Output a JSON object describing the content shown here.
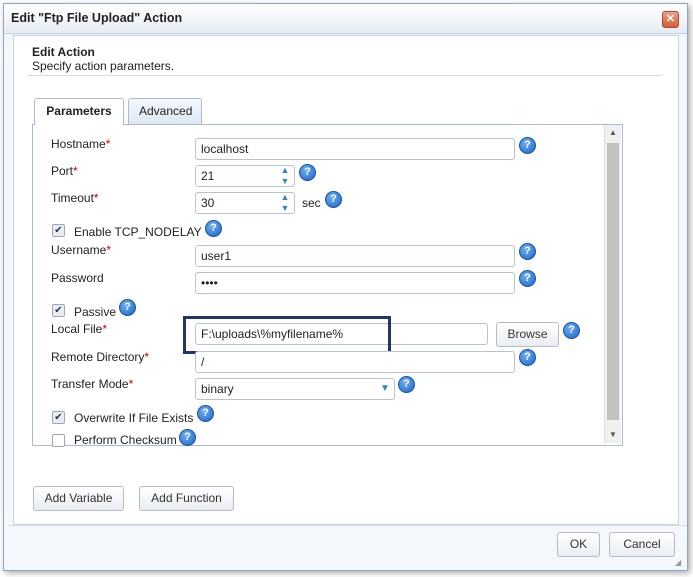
{
  "dialog": {
    "title": "Edit \"Ftp File Upload\" Action",
    "close_glyph": "✕",
    "header_title": "Edit Action",
    "header_subtitle": "Specify action parameters."
  },
  "tabs": [
    {
      "label": "Parameters",
      "active": true
    },
    {
      "label": "Advanced",
      "active": false
    }
  ],
  "form": {
    "hostname": {
      "label": "Hostname",
      "required": "*",
      "value": "localhost"
    },
    "port": {
      "label": "Port",
      "required": "*",
      "value": "21"
    },
    "timeout": {
      "label": "Timeout",
      "required": "*",
      "value": "30",
      "unit": "sec"
    },
    "enable_tcp_nodelay": {
      "label": "Enable TCP_NODELAY",
      "checked": true
    },
    "username": {
      "label": "Username",
      "required": "*",
      "value": "user1"
    },
    "password": {
      "label": "Password",
      "value": "••••"
    },
    "passive": {
      "label": "Passive",
      "checked": true
    },
    "local_file": {
      "label": "Local File",
      "required": "*",
      "value": "F:\\uploads\\%myfilename%",
      "browse_label": "Browse"
    },
    "remote_directory": {
      "label": "Remote Directory",
      "required": "*",
      "value": "/"
    },
    "transfer_mode": {
      "label": "Transfer Mode",
      "required": "*",
      "value": "binary"
    },
    "overwrite_if_exists": {
      "label": "Overwrite If File Exists",
      "checked": true
    },
    "perform_checksum": {
      "label": "Perform Checksum",
      "checked": false
    }
  },
  "icons": {
    "help": "?",
    "check": "✔",
    "spin_up": "▲",
    "spin_down": "▼",
    "dropdown": "▼",
    "scroll_up": "▲",
    "scroll_down": "▼"
  },
  "buttons": {
    "add_variable": "Add Variable",
    "add_function": "Add Function",
    "ok": "OK",
    "cancel": "Cancel"
  },
  "colors": {
    "accent": "#1b62c3",
    "required": "#cc0000",
    "highlight_border": "#1f3763"
  }
}
